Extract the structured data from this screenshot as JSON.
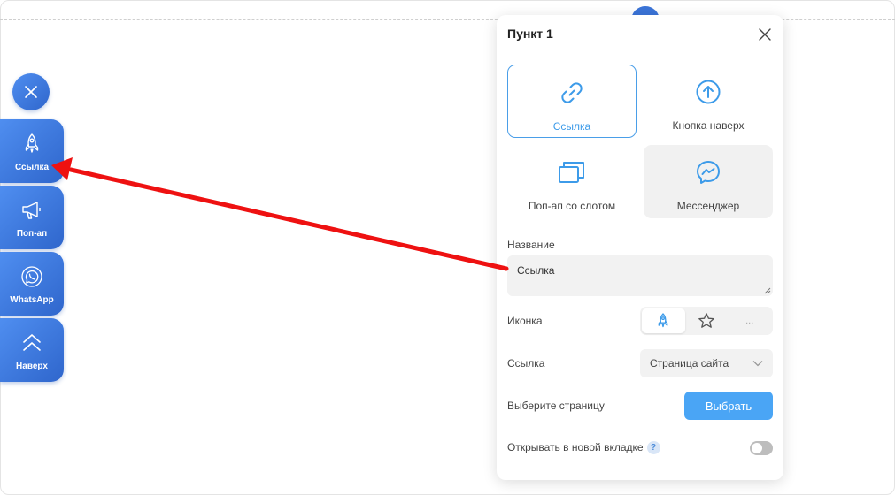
{
  "widget": {
    "buttons": [
      {
        "label": "Ссылка",
        "icon": "rocket-icon"
      },
      {
        "label": "Поп-ап",
        "icon": "megaphone-icon"
      },
      {
        "label": "WhatsApp",
        "icon": "whatsapp-icon"
      },
      {
        "label": "Наверх",
        "icon": "double-chevron-up-icon"
      }
    ]
  },
  "panel": {
    "title": "Пункт 1",
    "types": [
      {
        "label": "Ссылка",
        "icon": "link-icon",
        "state": "active"
      },
      {
        "label": "Кнопка наверх",
        "icon": "arrow-up-circle-icon",
        "state": "normal"
      },
      {
        "label": "Поп-ап со слотом",
        "icon": "windows-icon",
        "state": "normal"
      },
      {
        "label": "Мессенджер",
        "icon": "messenger-icon",
        "state": "hover"
      }
    ],
    "name_label": "Название",
    "name_value": "Ссылка",
    "icon_label": "Иконка",
    "icon_more": "...",
    "link_label": "Ссылка",
    "link_select": "Страница сайта",
    "page_label": "Выберите страницу",
    "choose_button": "Выбрать",
    "new_tab_label": "Открывать в новой вкладке",
    "help": "?",
    "new_tab_enabled": false
  },
  "colors": {
    "accent": "#3d9be9",
    "widget_blue": "#3b74d8",
    "arrow": "#ee1111"
  }
}
